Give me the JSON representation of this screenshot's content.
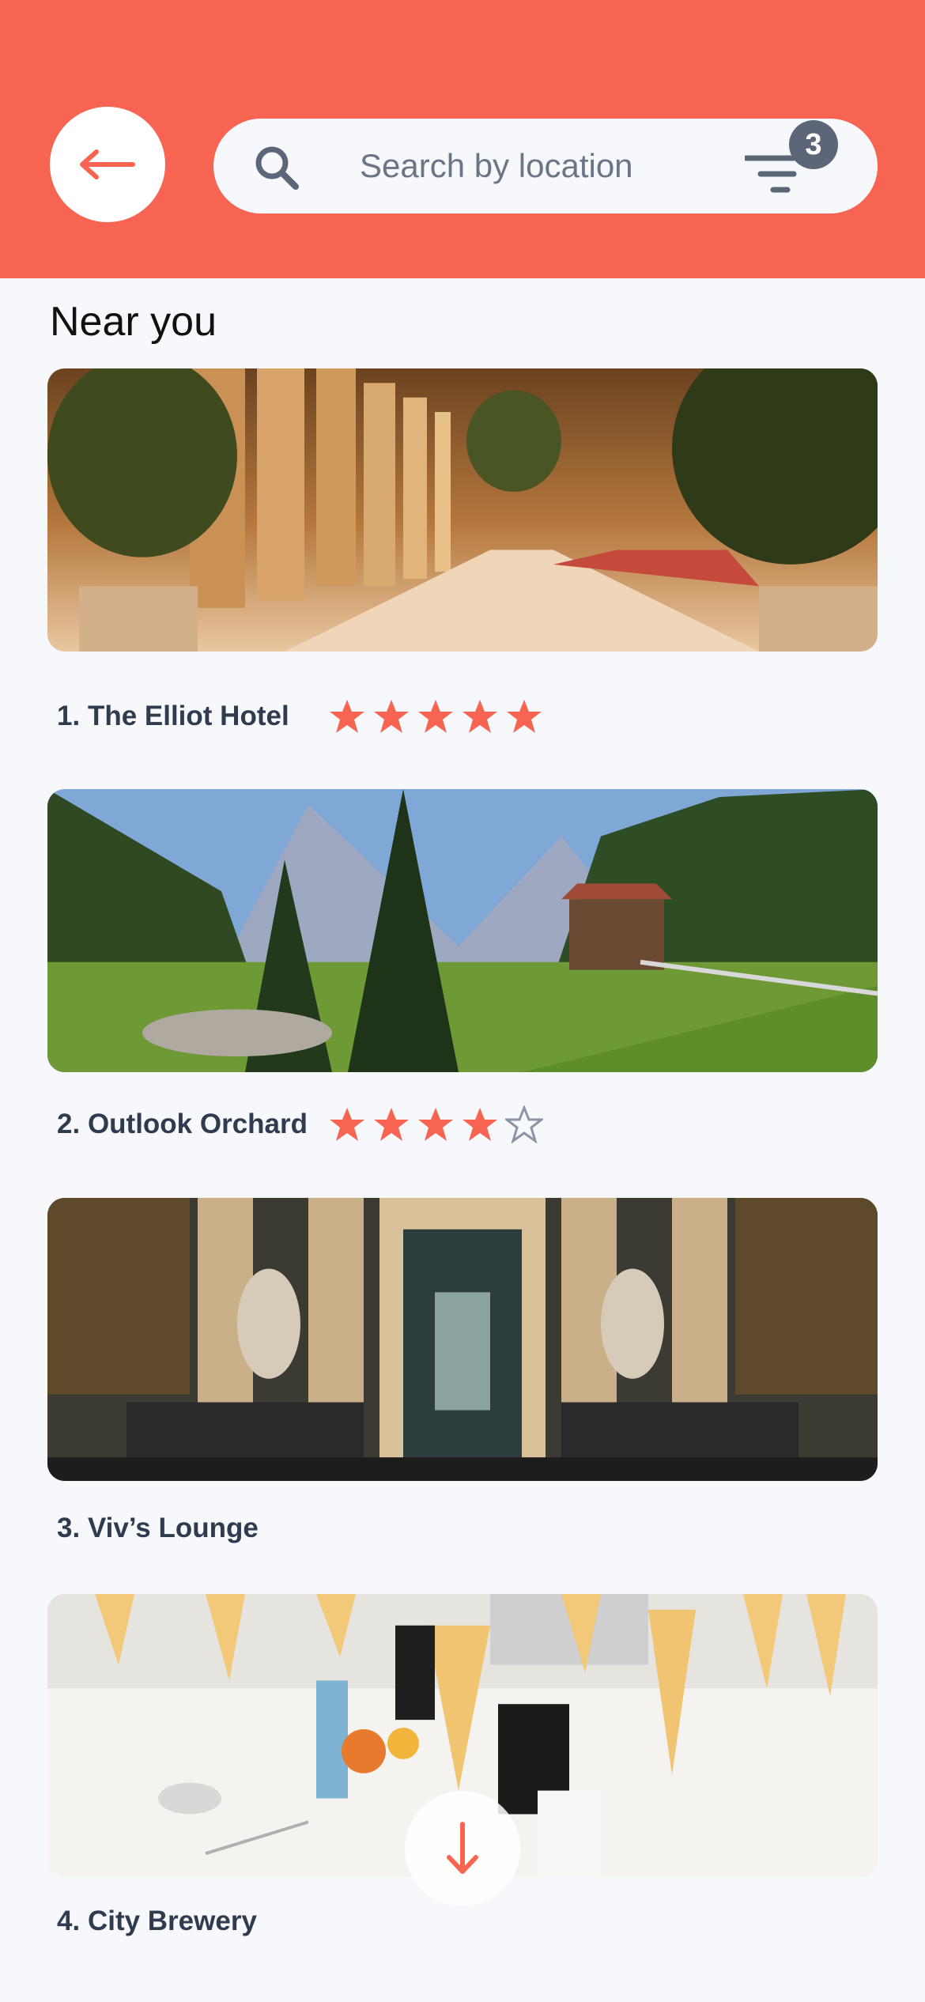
{
  "header": {
    "background_color": "#f76452",
    "back_icon": "arrow-left-icon",
    "search": {
      "placeholder": "Search by location",
      "value": "",
      "icon": "search-icon"
    },
    "filter": {
      "icon": "filter-icon",
      "badge_count": "3"
    }
  },
  "section": {
    "title": "Near you"
  },
  "places": [
    {
      "rank": "1.",
      "name": "The Elliot Hotel",
      "rating": 5,
      "rating_max": 5,
      "image": "hotel-lobby-image"
    },
    {
      "rank": "2.",
      "name": "Outlook Orchard",
      "rating": 4,
      "rating_max": 5,
      "image": "mountain-valley-image"
    },
    {
      "rank": "3.",
      "name": "Viv’s Lounge",
      "rating": null,
      "rating_max": null,
      "image": "ornate-hall-image"
    },
    {
      "rank": "4.",
      "name": "City Brewery",
      "rating": null,
      "rating_max": null,
      "image": "dining-table-image"
    }
  ],
  "scroll_button": {
    "icon": "arrow-down-icon"
  },
  "colors": {
    "accent": "#f76452",
    "text": "#2f3b4e",
    "star_filled": "#f76452",
    "star_empty": "#8a95a6"
  }
}
